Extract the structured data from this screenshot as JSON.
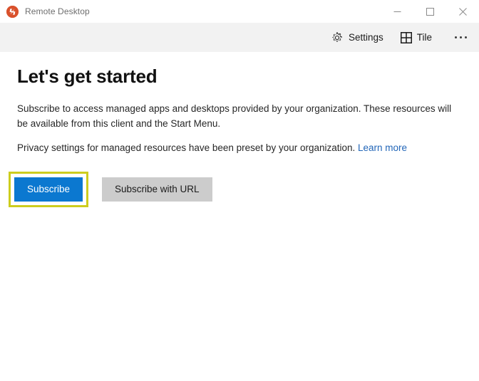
{
  "window": {
    "title": "Remote Desktop",
    "app_icon": "remote-desktop-icon",
    "controls": {
      "minimize": "minimize-icon",
      "maximize": "maximize-icon",
      "close": "close-icon"
    }
  },
  "toolbar": {
    "settings_label": "Settings",
    "settings_icon": "gear-icon",
    "tile_label": "Tile",
    "tile_icon": "grid-icon",
    "more_icon": "ellipsis-icon"
  },
  "main": {
    "heading": "Let's get started",
    "paragraph_1": "Subscribe to access managed apps and desktops provided by your organization. These resources will be available from this client and the Start Menu.",
    "paragraph_2_text": "Privacy settings for managed resources have been preset by your organization. ",
    "paragraph_2_link": "Learn more",
    "subscribe_label": "Subscribe",
    "subscribe_url_label": "Subscribe with URL"
  },
  "colors": {
    "accent_blue": "#0b78d0",
    "link_blue": "#2266b8",
    "highlight_yellow": "#cdcd1e",
    "toolbar_gray": "#f2f2f2",
    "secondary_button_gray": "#cccccc",
    "app_icon_orange": "#d9512c"
  }
}
